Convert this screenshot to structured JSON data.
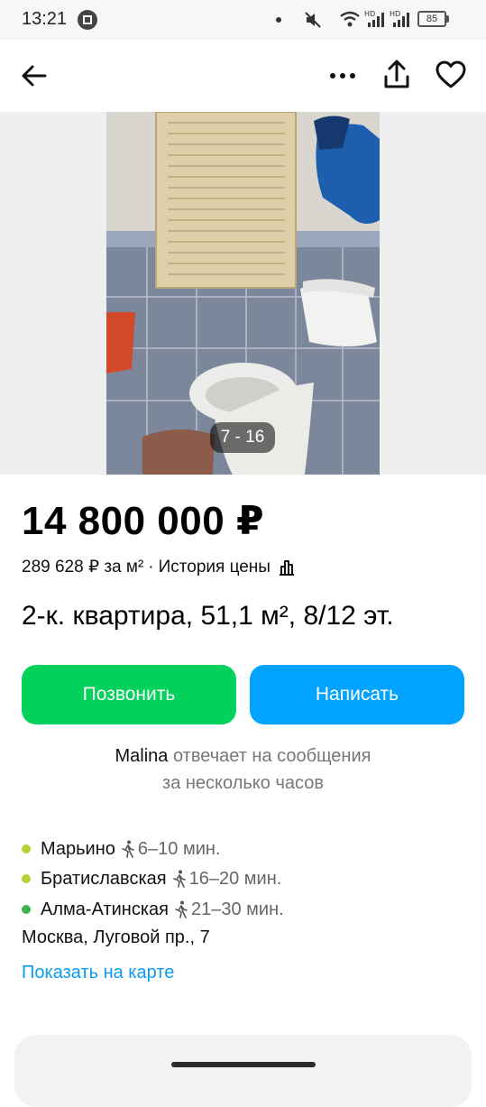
{
  "status_bar": {
    "time": "13:21",
    "battery": "85",
    "network_label_1": "HD",
    "network_label_2": "HD"
  },
  "toolbar": {
    "back_icon": "arrow-left-icon",
    "more_icon": "more-horizontal-icon",
    "share_icon": "share-icon",
    "favorite_icon": "heart-icon"
  },
  "gallery": {
    "counter": "7 - 16"
  },
  "listing": {
    "price": "14 800 000 ₽",
    "price_per_m2": "289 628 ₽ за м²",
    "separator": "·",
    "price_history": "История цены",
    "title": "2-к. квартира, 51,1 м², 8/12 эт."
  },
  "actions": {
    "call_label": "Позвонить",
    "write_label": "Написать",
    "call_color": "#02d15c",
    "write_color": "#00a3ff"
  },
  "seller": {
    "name": "Malina",
    "response_line1": "отвечает на сообщения",
    "response_line2": "за несколько часов"
  },
  "location": {
    "metro": [
      {
        "station": "Марьино",
        "time": "6–10 мин.",
        "color": "#b4d234"
      },
      {
        "station": "Братиславская",
        "time": "16–20 мин.",
        "color": "#b4d234"
      },
      {
        "station": "Алма-Атинская",
        "time": "21–30 мин.",
        "color": "#3fb24c"
      }
    ],
    "address": "Москва, Луговой пр., 7",
    "map_link": "Показать на карте"
  }
}
